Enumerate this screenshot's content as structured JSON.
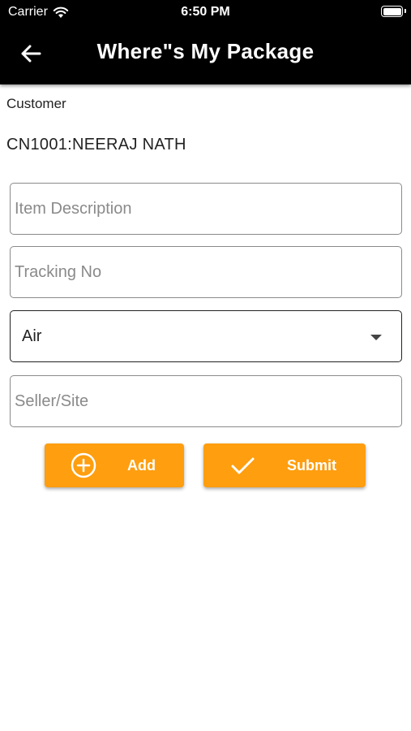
{
  "status_bar": {
    "carrier": "Carrier",
    "time": "6:50 PM"
  },
  "header": {
    "title": "Where\"s My Package",
    "back_icon": "arrow-left-icon"
  },
  "customer": {
    "label": "Customer",
    "value": "CN1001:NEERAJ NATH"
  },
  "form": {
    "item_description_placeholder": "Item Description",
    "tracking_no_placeholder": "Tracking No",
    "shipping_mode_value": "Air",
    "seller_site_placeholder": "Seller/Site"
  },
  "buttons": {
    "add_label": "Add",
    "add_icon": "plus-circle-icon",
    "submit_label": "Submit",
    "submit_icon": "check-icon"
  },
  "colors": {
    "accent": "#ff9e0f",
    "header_bg": "#000000"
  }
}
